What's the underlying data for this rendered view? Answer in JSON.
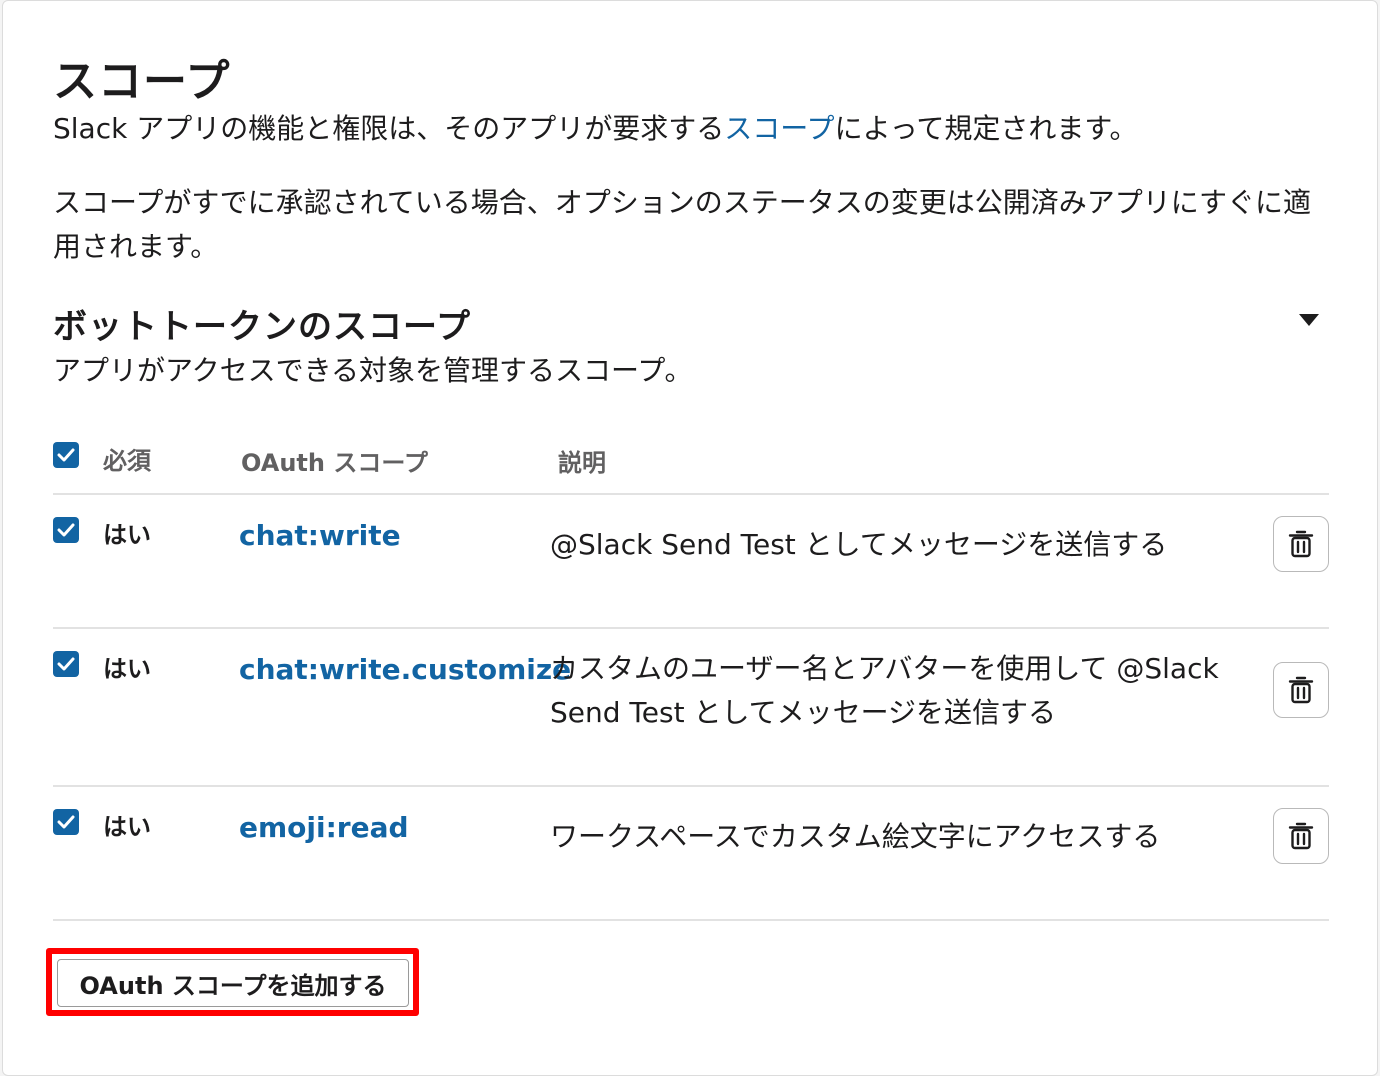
{
  "section": {
    "title": "スコープ",
    "intro_before": "Slack アプリの機能と権限は、そのアプリが要求する",
    "intro_link": "スコープ",
    "intro_after": "によって規定されます。",
    "note": "スコープがすでに承認されている場合、オプションのステータスの変更は公開済みアプリにすぐに適用されます。"
  },
  "bot_scopes": {
    "title": "ボットトークンのスコープ",
    "description": "アプリがアクセスできる対象を管理するスコープ。",
    "columns": {
      "required": "必須",
      "scope": "OAuth スコープ",
      "description": "説明"
    },
    "rows": [
      {
        "required": "はい",
        "scope": "chat:write",
        "description": "@Slack Send Test としてメッセージを送信する"
      },
      {
        "required": "はい",
        "scope": "chat:write.customize",
        "description": "カスタムのユーザー名とアバターを使用して @Slack Send Test としてメッセージを送信する"
      },
      {
        "required": "はい",
        "scope": "emoji:read",
        "description": "ワークスペースでカスタム絵文字にアクセスする"
      }
    ],
    "add_button": "OAuth スコープを追加する"
  },
  "colors": {
    "link": "#1264a3",
    "checkbox": "#1264a3",
    "highlight": "#ff0000"
  }
}
